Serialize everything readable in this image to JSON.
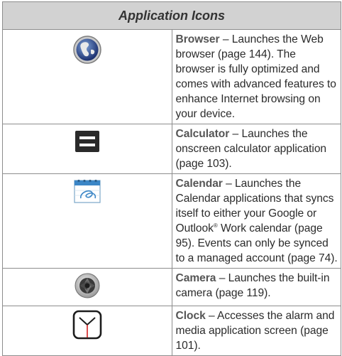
{
  "table": {
    "header": "Application Icons",
    "rows": [
      {
        "icon": "browser-globe-icon",
        "name": "Browser",
        "dash": " – ",
        "text": "Launches the Web browser (page 144). The browser is fully optimized and comes with advanced features to enhance Internet browsing on your device."
      },
      {
        "icon": "calculator-icon",
        "name": "Calculator",
        "dash": " – ",
        "text": "Launches the onscreen calculator application (page 103)."
      },
      {
        "icon": "calendar-icon",
        "name": "Calendar",
        "dash": " – ",
        "text_before_mark": "Launches the Calendar applications that syncs itself to either your Google or Outlook",
        "mark": "®",
        "text_after_mark": " Work calendar (page 95). Events can only be synced to a managed account (page 74)."
      },
      {
        "icon": "camera-aperture-icon",
        "name": "Camera",
        "dash": " – ",
        "text": "Launches the built-in camera (page 119)."
      },
      {
        "icon": "clock-icon",
        "name": "Clock",
        "dash": " – ",
        "text": "Accesses the alarm and media application screen (page 101)."
      }
    ]
  }
}
